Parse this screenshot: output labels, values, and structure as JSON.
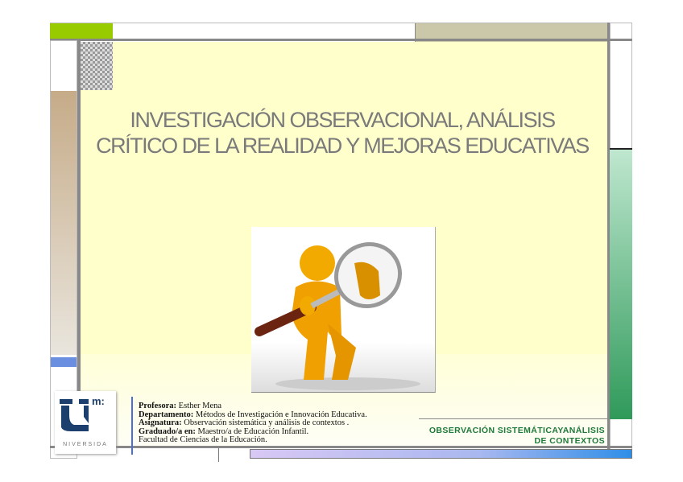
{
  "slide": {
    "title": "INVESTIGACIÓN OBSERVACIONAL, ANÁLISIS CRÍTICO DE LA REALIDAD Y MEJORAS EDUCATIVAS",
    "info": [
      {
        "label": "Profesora:",
        "value": " Esther Mena"
      },
      {
        "label": "Departamento:",
        "value": " Métodos de Investigación e Innovación Educativa."
      },
      {
        "label": "Asignatura:",
        "value": " Observación sistemática y análisis de contextos ."
      },
      {
        "label": "Graduado/a en:",
        "value": " Maestro/a de Educación Infantil."
      },
      {
        "label": "",
        "value": "Facultad de Ciencias de la Educación."
      }
    ],
    "course_line1": "OBSERVACIÓN SISTEMÁTICAYANÁLISIS",
    "course_line2": "DE CONTEXTOS",
    "logo_text": "NIVERSIDA",
    "logo_mark": "m:",
    "image_icon": "person-with-magnifier-icon"
  },
  "colors": {
    "accent_green": "#99cc00",
    "course_green": "#1e7a3a",
    "background": "#ffffcc",
    "logo_blue": "#1c3f6e"
  }
}
